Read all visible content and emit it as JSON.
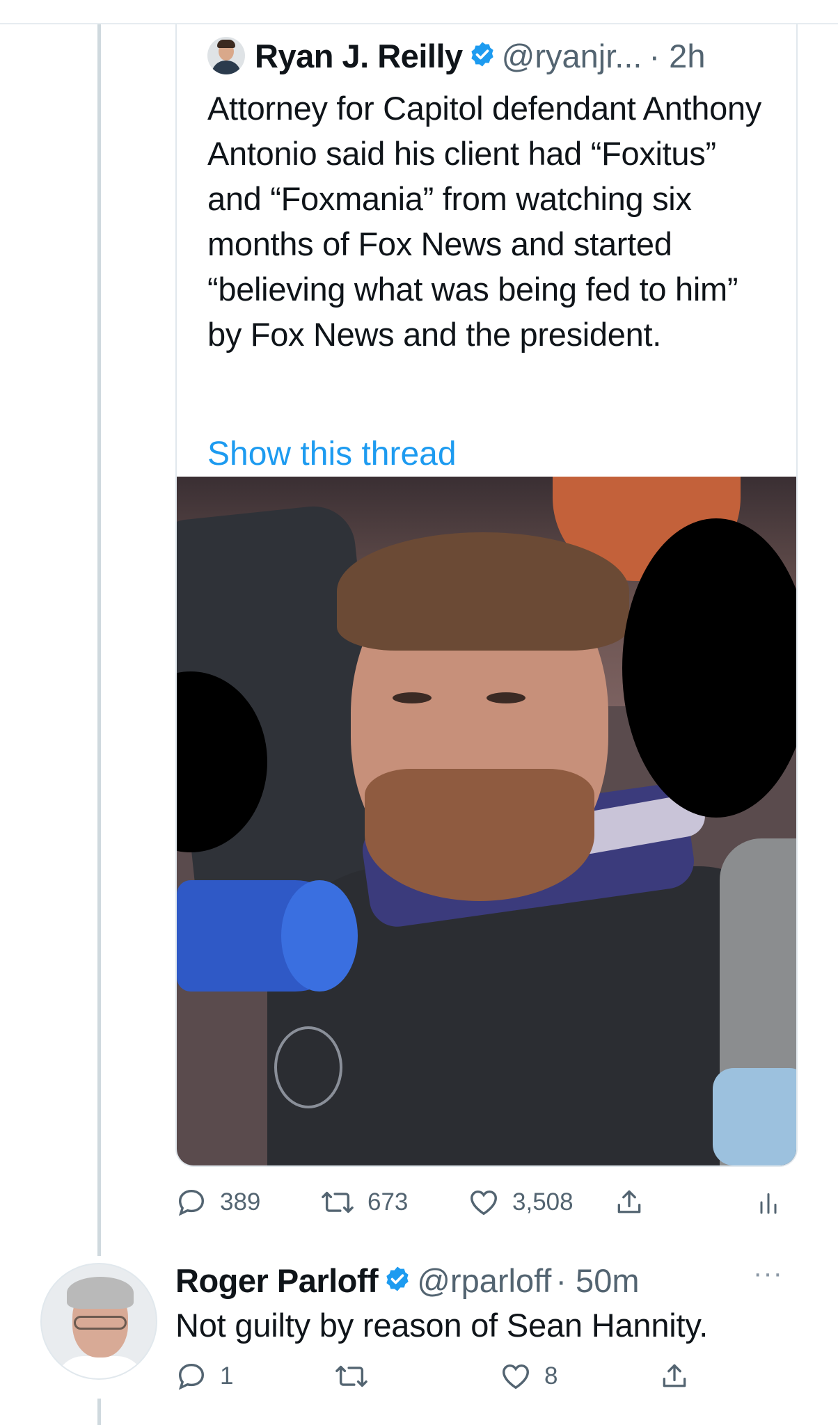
{
  "quoted_tweet": {
    "name": "Ryan J. Reilly",
    "handle": "@ryanjr...",
    "time": "· 2h",
    "text": "Attorney for Capitol defendant Anthony Antonio said his client had “Foxitus” and “Foxmania” from watching six months of Fox News and started “believing what was being fed to him” by Fox News and the president.",
    "show_thread": "Show this thread",
    "photo_icon": "photo-with-redacted-faces",
    "replies": "389",
    "retweets": "673",
    "likes": "3,508"
  },
  "reply_tweet": {
    "name": "Roger Parloff",
    "handle": "@rparloff",
    "time": "· 50m",
    "text": "Not guilty by reason of Sean Hannity.",
    "replies": "1",
    "likes": "8",
    "more": "···"
  },
  "colors": {
    "accent": "#1d9bf0",
    "muted": "#536471",
    "thread_line": "#cfd9de"
  }
}
